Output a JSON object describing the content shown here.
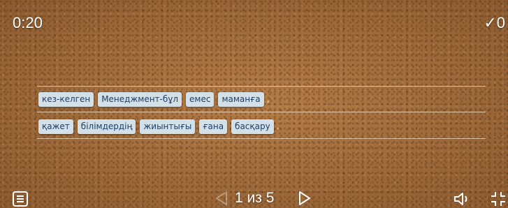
{
  "timer": "0:20",
  "score": "✓0",
  "sentence": {
    "row1": [
      "кез-келген",
      "Менеджмент-бұл",
      "емес",
      "маманға"
    ],
    "row1_punct": ",",
    "row2": [
      "қажет",
      "білімдердің",
      "жиынтығы",
      "ғана",
      "басқару"
    ],
    "row2_punct": "."
  },
  "pager": {
    "text": "1 из 5",
    "current": 1,
    "total": 5
  },
  "icons": [
    "menu-icon",
    "prev-arrow-icon",
    "next-arrow-icon",
    "sound-icon",
    "fullscreen-icon"
  ],
  "colors": {
    "tile_bg": "#d3e0e8",
    "tile_text": "#1d3f66",
    "board": "#b07a45"
  }
}
